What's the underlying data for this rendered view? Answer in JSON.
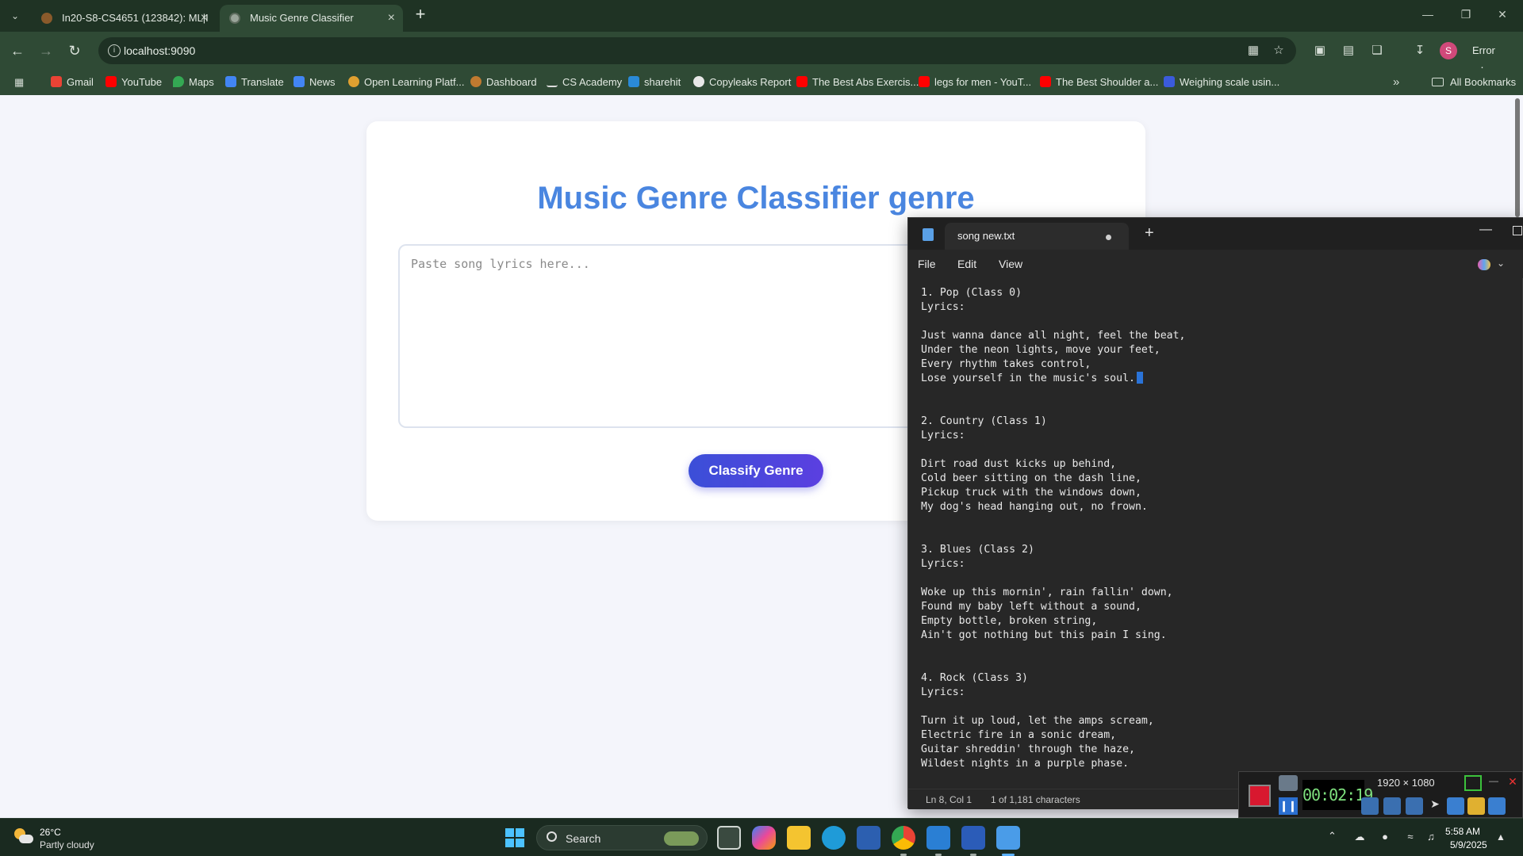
{
  "browser": {
    "tabs": [
      {
        "label": "In20-S8-CS4651 (123842): ML|I",
        "active": false
      },
      {
        "label": "Music Genre Classifier",
        "active": true
      }
    ],
    "url": "localhost:9090",
    "profile_initial": "S",
    "error_label": "Error",
    "bookmarks": [
      {
        "label": "Gmail",
        "icon": "gmail-icon",
        "color": "#ea4335"
      },
      {
        "label": "YouTube",
        "icon": "youtube-icon",
        "color": "#ff0000"
      },
      {
        "label": "Maps",
        "icon": "maps-icon",
        "color": "#34a853"
      },
      {
        "label": "Translate",
        "icon": "translate-icon",
        "color": "#4285f4"
      },
      {
        "label": "News",
        "icon": "news-icon",
        "color": "#4285f4"
      },
      {
        "label": "Open Learning Platf...",
        "icon": "open-learning-icon",
        "color": "#e0a030"
      },
      {
        "label": "Dashboard",
        "icon": "dashboard-icon",
        "color": "#c07a30"
      },
      {
        "label": "CS Academy",
        "icon": "cs-academy-icon",
        "color": "#dddddd"
      },
      {
        "label": "sharehit",
        "icon": "sharehit-icon",
        "color": "#2a8ad8"
      },
      {
        "label": "Copyleaks Report",
        "icon": "copyleaks-icon",
        "color": "#e8e8e8"
      },
      {
        "label": "The Best Abs Exercis...",
        "icon": "youtube-icon",
        "color": "#ff0000"
      },
      {
        "label": "legs for men - YouT...",
        "icon": "youtube-icon",
        "color": "#ff0000"
      },
      {
        "label": "The Best Shoulder a...",
        "icon": "youtube-icon",
        "color": "#ff0000"
      },
      {
        "label": "Weighing scale usin...",
        "icon": "weighing-scale-icon",
        "color": "#3b5bdb"
      }
    ],
    "all_bookmarks_label": "All Bookmarks"
  },
  "page": {
    "title": "Music Genre Classifier genre",
    "lyrics_placeholder": "Paste song lyrics here...",
    "classify_label": "Classify Genre",
    "accent_color": "#4a86e0"
  },
  "notepad": {
    "file_name": "song new.txt",
    "menus": [
      "File",
      "Edit",
      "View"
    ],
    "lines": [
      "1. Pop (Class 0)",
      "Lyrics:",
      "",
      "Just wanna dance all night, feel the beat,",
      "Under the neon lights, move your feet,",
      "Every rhythm takes control,",
      "Lose yourself in the music's soul.",
      "",
      "",
      "2. Country (Class 1)",
      "Lyrics:",
      "",
      "Dirt road dust kicks up behind,",
      "Cold beer sitting on the dash line,",
      "Pickup truck with the windows down,",
      "My dog's head hanging out, no frown.",
      "",
      "",
      "3. Blues (Class 2)",
      "Lyrics:",
      "",
      "Woke up this mornin', rain fallin' down,",
      "Found my baby left without a sound,",
      "Empty bottle, broken string,",
      "Ain't got nothing but this pain I sing.",
      "",
      "",
      "4. Rock (Class 3)",
      "Lyrics:",
      "",
      "Turn it up loud, let the amps scream,",
      "Electric fire in a sonic dream,",
      "Guitar shreddin' through the haze,",
      "Wildest nights in a purple phase."
    ],
    "status_position": "Ln 8, Col 1",
    "status_chars": "1 of 1,181 characters"
  },
  "recorder": {
    "timer": "00:02:19",
    "resolution": "1920 × 1080"
  },
  "taskbar": {
    "weather_temp": "26°C",
    "weather_desc": "Partly cloudy",
    "search_label": "Search",
    "time": "5:58 AM",
    "date": "5/9/2025"
  }
}
